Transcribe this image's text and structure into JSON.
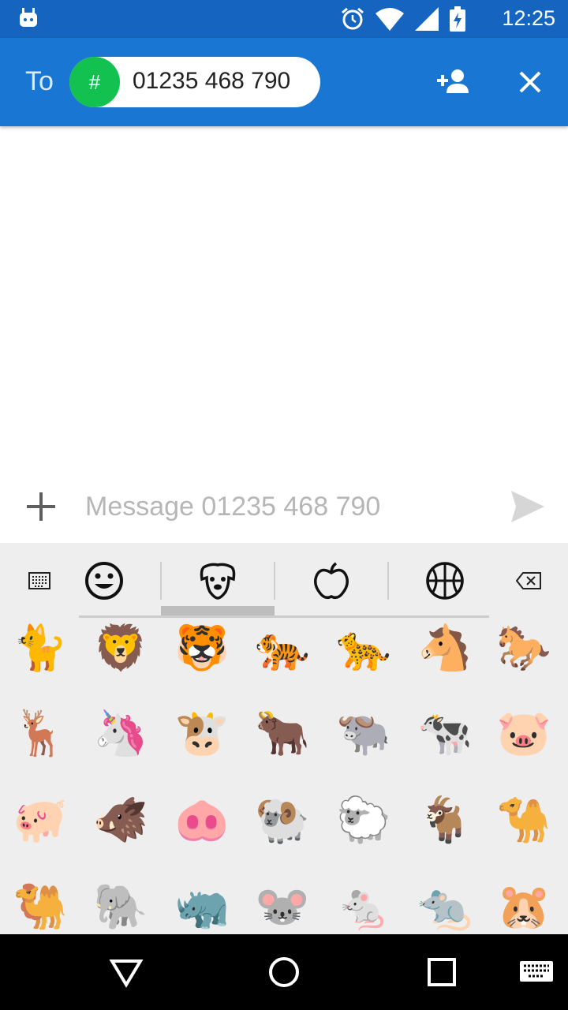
{
  "status_bar": {
    "time": "12:25",
    "icons": [
      "android-notification-icon",
      "alarm-icon",
      "wifi-icon",
      "cell-signal-icon",
      "battery-charging-icon"
    ]
  },
  "app_bar": {
    "to_label": "To",
    "recipient": {
      "avatar_symbol": "#",
      "number": "01235 468 790",
      "avatar_color": "#12c14f"
    },
    "actions": [
      "add-contact-icon",
      "close-icon"
    ],
    "color": "#1976d2"
  },
  "composer": {
    "placeholder": "Message 01235 468 790",
    "value": ""
  },
  "emoji_keyboard": {
    "categories": [
      "keyboard-icon",
      "smiley-icon",
      "dog-face-icon",
      "apple-icon",
      "basketball-icon",
      "backspace-icon"
    ],
    "active_category": "animals",
    "rows": [
      [
        "🐈",
        "🦁",
        "🐯",
        "🐅",
        "🐆",
        "🐴",
        "🐎"
      ],
      [
        "🦌",
        "🦄",
        "🐮",
        "🐂",
        "🐃",
        "🐄",
        "🐷"
      ],
      [
        "🐖",
        "🐗",
        "🐽",
        "🐏",
        "🐑",
        "🐐",
        "🐪"
      ],
      [
        "🐫",
        "🐘",
        "🦏",
        "🐭",
        "🐁",
        "🐀",
        "🐹"
      ]
    ]
  },
  "nav_bar": {
    "buttons": [
      "back-icon",
      "home-icon",
      "recents-icon",
      "keyboard-switch-icon"
    ]
  }
}
